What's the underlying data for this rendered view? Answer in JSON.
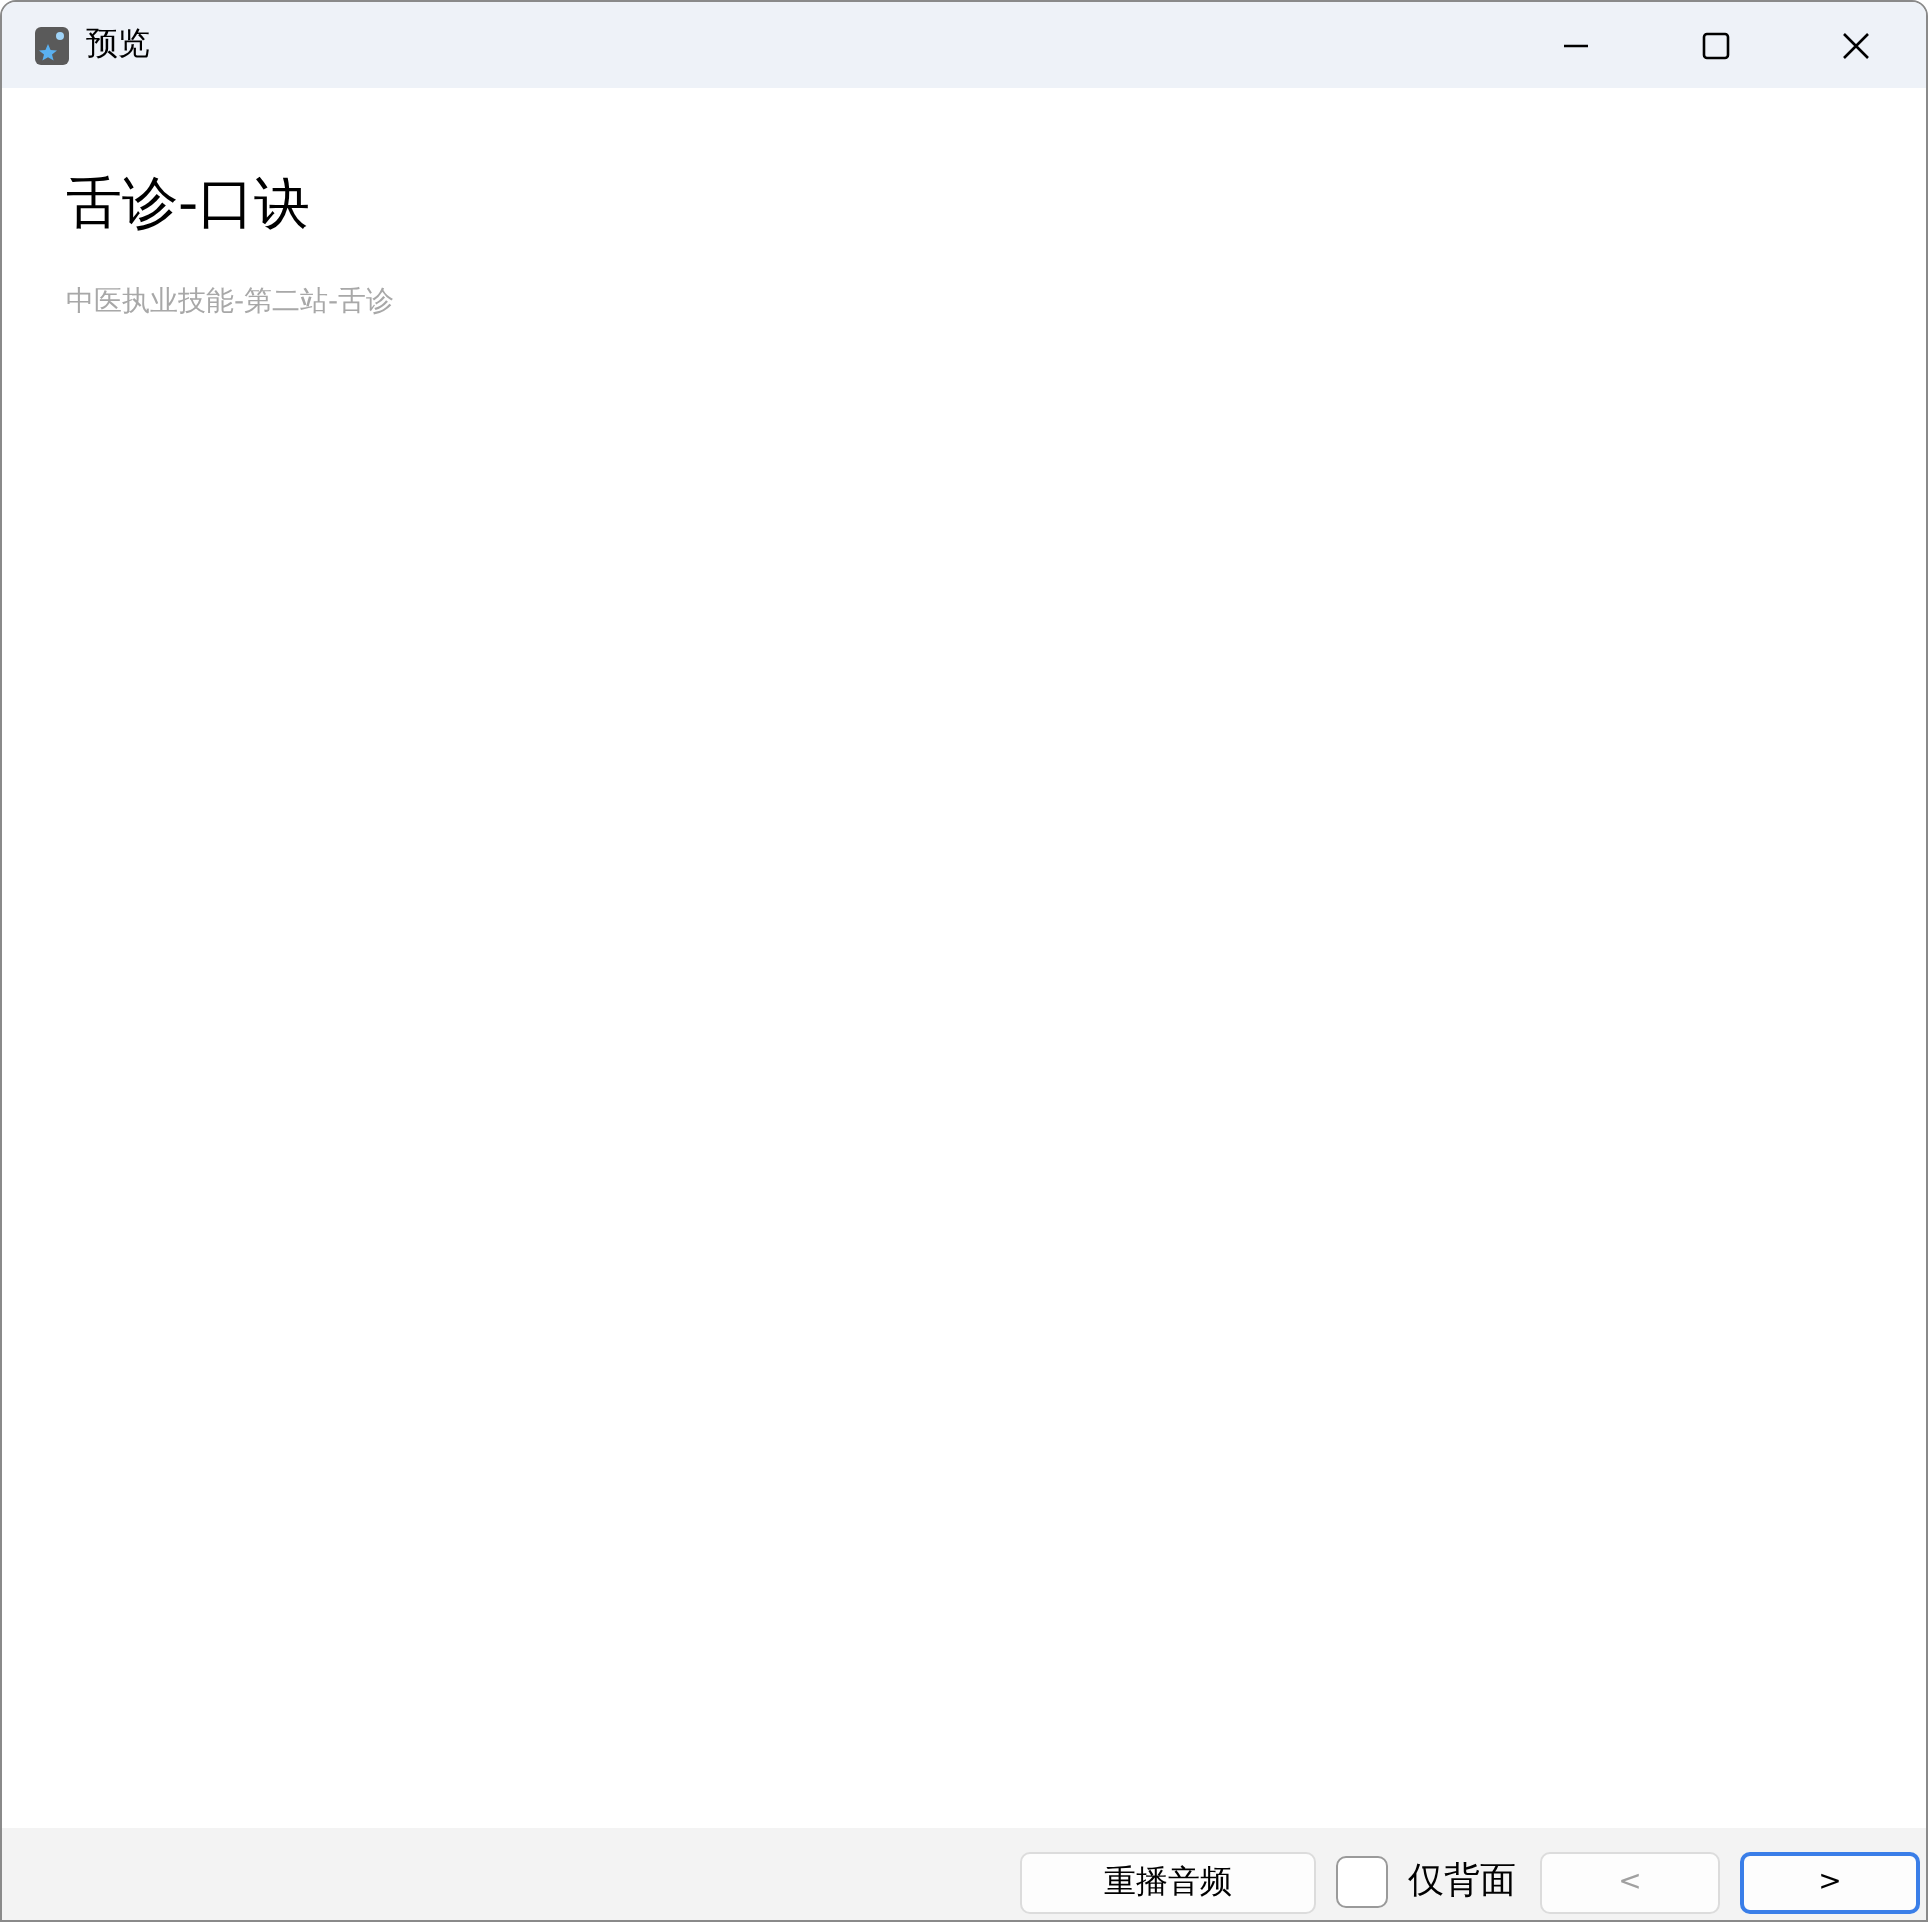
{
  "window": {
    "title": "预览"
  },
  "card": {
    "title": "舌诊-口诀",
    "subtitle": "中医执业技能-第二站-舌诊"
  },
  "footer": {
    "replay_button": {
      "label": "重播音频"
    },
    "back_only": {
      "label": "仅背面",
      "checked": false
    },
    "prev_button": {
      "label": "<",
      "disabled": true
    },
    "next_button": {
      "label": ">",
      "focused": true
    }
  }
}
